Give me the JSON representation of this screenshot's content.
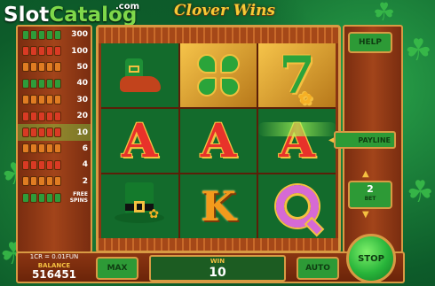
{
  "logo": {
    "part1": "Slot",
    "part2": "Catalog",
    "suffix": ".com"
  },
  "game": {
    "title": "Clover Wins"
  },
  "paytable": [
    {
      "value": "300",
      "syms": "ggggg"
    },
    {
      "value": "100",
      "syms": "rrrrr"
    },
    {
      "value": "50",
      "syms": "ooooo"
    },
    {
      "value": "40",
      "syms": "ggggg"
    },
    {
      "value": "30",
      "syms": "ooooo"
    },
    {
      "value": "20",
      "syms": "rrrrr"
    },
    {
      "value": "10",
      "syms": "rrrrr",
      "highlight": true
    },
    {
      "value": "6",
      "syms": "ooooo"
    },
    {
      "value": "4",
      "syms": "rrrrr"
    },
    {
      "value": "2",
      "syms": "ooooo"
    },
    {
      "value": "FREE SPINS",
      "syms": "ggggg"
    }
  ],
  "reels": [
    [
      {
        "sym": "boot",
        "style": "dark"
      },
      {
        "sym": "clover",
        "style": "gold"
      },
      {
        "sym": "seven",
        "style": "gold"
      }
    ],
    [
      {
        "sym": "A",
        "style": "dark"
      },
      {
        "sym": "A",
        "style": "dark"
      },
      {
        "sym": "A",
        "style": "dark"
      }
    ],
    [
      {
        "sym": "hat",
        "style": "dark"
      },
      {
        "sym": "K",
        "style": "dark"
      },
      {
        "sym": "Q",
        "style": "dark"
      }
    ]
  ],
  "side": {
    "help": "HELP",
    "payline": "PAYLINE",
    "bet_value": "2",
    "bet_label": "BET"
  },
  "footer": {
    "denomination": "1CR = 0.01FUN",
    "balance_label": "BALANCE",
    "balance_value": "516451",
    "max": "MAX",
    "win_label": "WIN",
    "win_value": "10",
    "auto": "AUTO",
    "stop": "STOP"
  },
  "colors": {
    "frame": "#8a3512",
    "border": "#d89a43",
    "button": "#2d9a36",
    "accent_gold": "#f4c040"
  },
  "icons": [
    "boot-symbol",
    "clover-symbol",
    "seven-symbol",
    "hat-symbol"
  ]
}
